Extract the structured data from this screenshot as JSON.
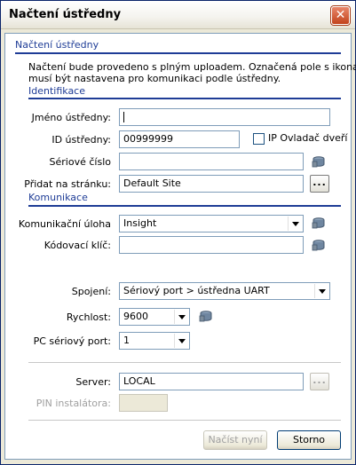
{
  "window": {
    "title": "Načtení ústředny"
  },
  "header": {
    "title": "Načtení ústředny",
    "description_line1": "Načtení bude provedeno s plným uploadem. Označená pole s ikonami",
    "description_line2": "musí být nastavena pro komunikaci podle ústředny."
  },
  "identification": {
    "section_title": "Identifikace",
    "name_label": "Jméno ústředny:",
    "name_value": "",
    "id_label": "ID ústředny:",
    "id_value": "00999999",
    "ip_checkbox_label": "IP Ovladač dveří",
    "serial_label": "Sériové číslo",
    "serial_value": "",
    "page_label": "Přidat na stránku:",
    "page_value": "Default Site",
    "browse_label": "..."
  },
  "communication": {
    "section_title": "Komunikace",
    "task_label": "Komunikační úloha",
    "task_value": "Insight",
    "key_label": "Kódovací klíč:",
    "key_value": "",
    "connection_label": "Spojení:",
    "connection_value": "Sériový port > ústředna UART",
    "speed_label": "Rychlost:",
    "speed_value": "9600",
    "port_label": "PC sériový port:",
    "port_value": "1",
    "server_label": "Server:",
    "server_value": "LOCAL",
    "server_browse_label": "...",
    "pin_label": "PIN instalátora:",
    "pin_value": ""
  },
  "footer": {
    "load_label": "Načíst nyní",
    "cancel_label": "Storno"
  }
}
